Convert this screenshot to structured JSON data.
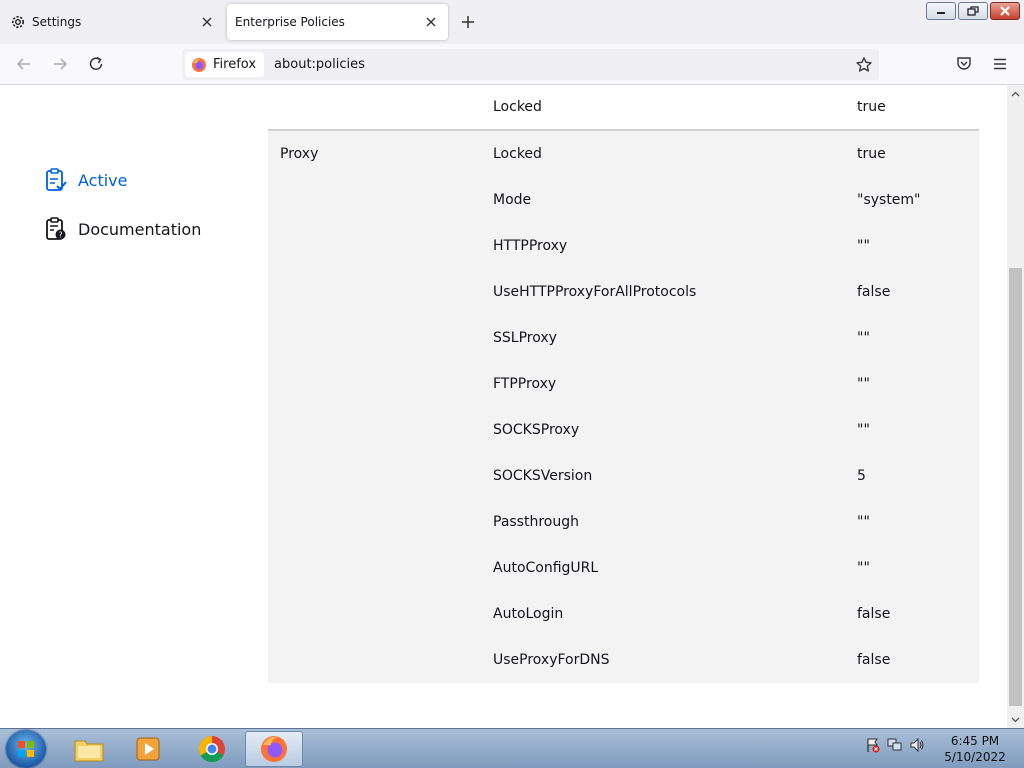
{
  "tabs": [
    {
      "title": "Settings",
      "icon": "gear-icon",
      "active": false
    },
    {
      "title": "Enterprise Policies",
      "icon": "",
      "active": true
    }
  ],
  "urlbar": {
    "identity_label": "Firefox",
    "url": "about:policies"
  },
  "sidebar": {
    "items": [
      {
        "label": "Active",
        "icon": "clipboard-check-icon",
        "selected": true
      },
      {
        "label": "Documentation",
        "icon": "clipboard-help-icon",
        "selected": false
      }
    ]
  },
  "policies": {
    "top_row": {
      "policy": "",
      "name": "Locked",
      "value": "true"
    },
    "proxy_group": {
      "policy": "Proxy",
      "rows": [
        {
          "name": "Locked",
          "value": "true"
        },
        {
          "name": "Mode",
          "value": "\"system\""
        },
        {
          "name": "HTTPProxy",
          "value": "\"\""
        },
        {
          "name": "UseHTTPProxyForAllProtocols",
          "value": "false"
        },
        {
          "name": "SSLProxy",
          "value": "\"\""
        },
        {
          "name": "FTPProxy",
          "value": "\"\""
        },
        {
          "name": "SOCKSProxy",
          "value": "\"\""
        },
        {
          "name": "SOCKSVersion",
          "value": "5"
        },
        {
          "name": "Passthrough",
          "value": "\"\""
        },
        {
          "name": "AutoConfigURL",
          "value": "\"\""
        },
        {
          "name": "AutoLogin",
          "value": "false"
        },
        {
          "name": "UseProxyForDNS",
          "value": "false"
        }
      ]
    }
  },
  "taskbar": {
    "apps": [
      "file-explorer-icon",
      "media-player-icon",
      "chrome-icon",
      "firefox-icon"
    ],
    "time": "6:45 PM",
    "date": "5/10/2022"
  },
  "colors": {
    "accent": "#0061e0",
    "table_bg": "#f3f3f3"
  }
}
